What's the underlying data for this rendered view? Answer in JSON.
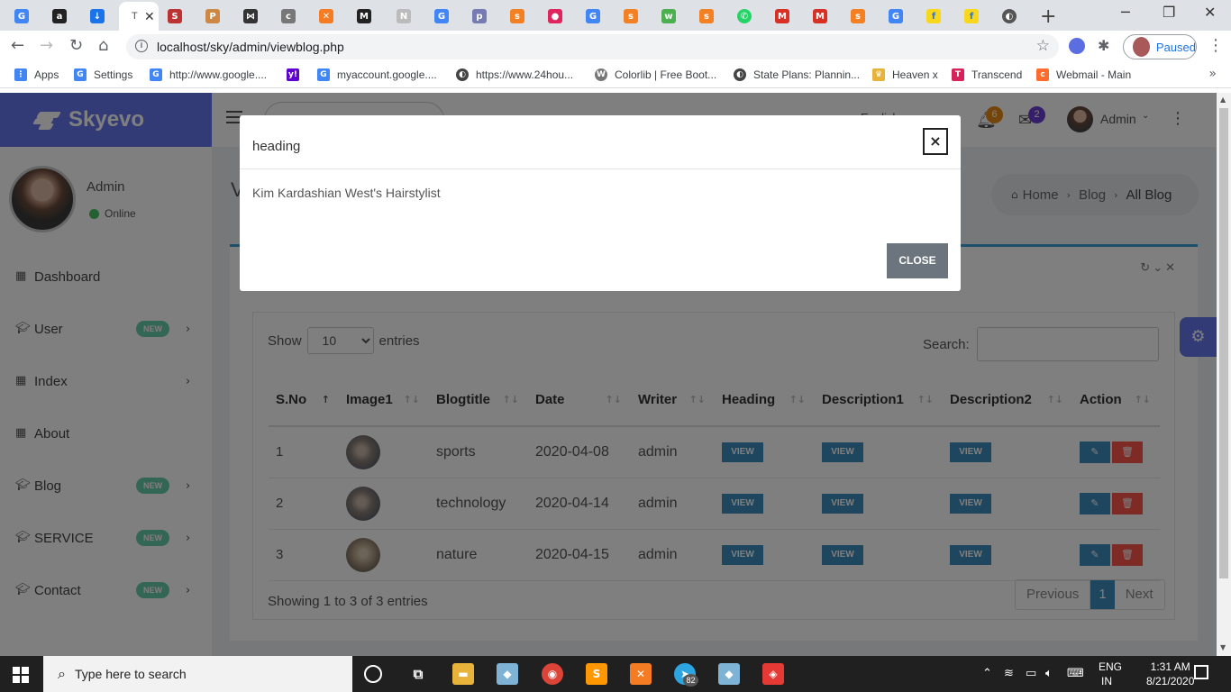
{
  "browser": {
    "active_tab_title": "T",
    "url": "localhost/sky/admin/viewblog.php",
    "profile_label": "Paused",
    "bookmarks": [
      {
        "label": "Apps",
        "color": "#4285f4",
        "glyph": "⋮"
      },
      {
        "label": "Settings",
        "color": "#4285f4",
        "glyph": "G"
      },
      {
        "label": "http://www.google....",
        "color": "#4285f4",
        "glyph": "G"
      },
      {
        "label": "",
        "color": "#5f01d1",
        "glyph": "y!"
      },
      {
        "label": "myaccount.google....",
        "color": "#4285f4",
        "glyph": "G"
      },
      {
        "label": "https://www.24hou...",
        "color": "#444444",
        "glyph": "◐"
      },
      {
        "label": "Colorlib | Free Boot...",
        "color": "#777777",
        "glyph": "W"
      },
      {
        "label": "State Plans: Plannin...",
        "color": "#444444",
        "glyph": "◐"
      },
      {
        "label": "Heaven x",
        "color": "#e8b33a",
        "glyph": "♛"
      },
      {
        "label": "Transcend",
        "color": "#d6245a",
        "glyph": "T"
      },
      {
        "label": "Webmail - Main",
        "color": "#ff6c2c",
        "glyph": "c"
      }
    ]
  },
  "app": {
    "brand": "Skyevo",
    "language": "English",
    "notifications_count": "6",
    "messages_count": "2",
    "user_name": "Admin",
    "page_title": "V",
    "breadcrumb": [
      "Home",
      "Blog",
      "All Blog"
    ],
    "colors": {
      "primary": "#6777ef",
      "info": "#3c8dbc",
      "danger": "#fc544b",
      "success": "#47c363"
    }
  },
  "sidebar": {
    "user_name": "Admin",
    "status": "Online",
    "items": [
      {
        "label": "Dashboard",
        "icon": "grid-icon",
        "badge": "",
        "submenu": false
      },
      {
        "label": "User",
        "icon": "graduation-cap-icon",
        "badge": "NEW",
        "submenu": true
      },
      {
        "label": "Index",
        "icon": "grid-icon",
        "badge": "",
        "submenu": true
      },
      {
        "label": "About",
        "icon": "grid-icon",
        "badge": "",
        "submenu": false
      },
      {
        "label": "Blog",
        "icon": "graduation-cap-icon",
        "badge": "NEW",
        "submenu": true
      },
      {
        "label": "SERVICE",
        "icon": "graduation-cap-icon",
        "badge": "NEW",
        "submenu": true
      },
      {
        "label": "Contact",
        "icon": "graduation-cap-icon",
        "badge": "NEW",
        "submenu": true
      }
    ]
  },
  "table": {
    "show_label": "Show",
    "entries_value": "10",
    "entries_label": "entries",
    "search_label": "Search:",
    "search_value": "",
    "columns": [
      "S.No",
      "Image1",
      "Blogtitle",
      "Date",
      "Writer",
      "Heading",
      "Description1",
      "Description2",
      "Action"
    ],
    "view_label": "VIEW",
    "rows": [
      {
        "sno": "1",
        "title": "sports",
        "date": "2020-04-08",
        "writer": "admin"
      },
      {
        "sno": "2",
        "title": "technology",
        "date": "2020-04-14",
        "writer": "admin"
      },
      {
        "sno": "3",
        "title": "nature",
        "date": "2020-04-15",
        "writer": "admin"
      }
    ],
    "info": "Showing 1 to 3 of 3 entries",
    "pager": {
      "prev": "Previous",
      "current": "1",
      "next": "Next"
    }
  },
  "modal": {
    "title": "heading",
    "body": "Kim Kardashian West's Hairstylist",
    "close_x": "×",
    "close_label": "CLOSE"
  },
  "taskbar": {
    "search_placeholder": "Type here to search",
    "telegram_badge": "82",
    "lang_line1": "ENG",
    "lang_line2": "IN",
    "time": "1:31 AM",
    "date": "8/21/2020"
  }
}
